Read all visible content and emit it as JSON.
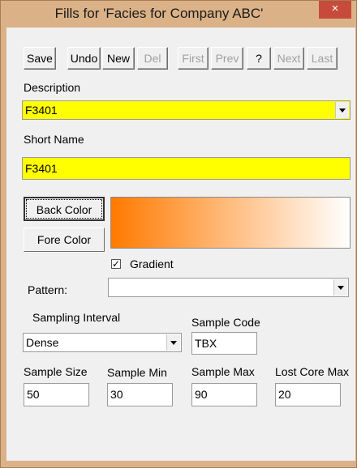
{
  "window": {
    "title": "Fills for 'Facies for Company ABC'",
    "close_glyph": "×"
  },
  "toolbar": {
    "buttons": [
      {
        "label": "Save",
        "enabled": true
      },
      {
        "label": "Undo",
        "enabled": true
      },
      {
        "label": "New",
        "enabled": true
      },
      {
        "label": "Del",
        "enabled": false
      },
      {
        "label": "First",
        "enabled": false
      },
      {
        "label": "Prev",
        "enabled": false
      },
      {
        "label": "?",
        "enabled": true
      },
      {
        "label": "Next",
        "enabled": false
      },
      {
        "label": "Last",
        "enabled": false
      }
    ]
  },
  "description": {
    "label": "Description",
    "value": "F3401"
  },
  "short_name": {
    "label": "Short Name",
    "value": "F3401"
  },
  "colors": {
    "back_color_label": "Back Color",
    "fore_color_label": "Fore Color",
    "gradient_from": "#ff7a00",
    "gradient_to": "#ffffff",
    "highlight": "#ffff00"
  },
  "gradient": {
    "label": "Gradient",
    "checked": true
  },
  "pattern": {
    "label": "Pattern:",
    "value": ""
  },
  "sampling_interval": {
    "label": "Sampling Interval",
    "value": "Dense"
  },
  "sample_code": {
    "label": "Sample Code",
    "value": "TBX"
  },
  "sample_size": {
    "label": "Sample Size",
    "value": "50"
  },
  "sample_min": {
    "label": "Sample Min",
    "value": "30"
  },
  "sample_max": {
    "label": "Sample Max",
    "value": "90"
  },
  "lost_core_max": {
    "label": "Lost Core Max",
    "value": "20"
  }
}
